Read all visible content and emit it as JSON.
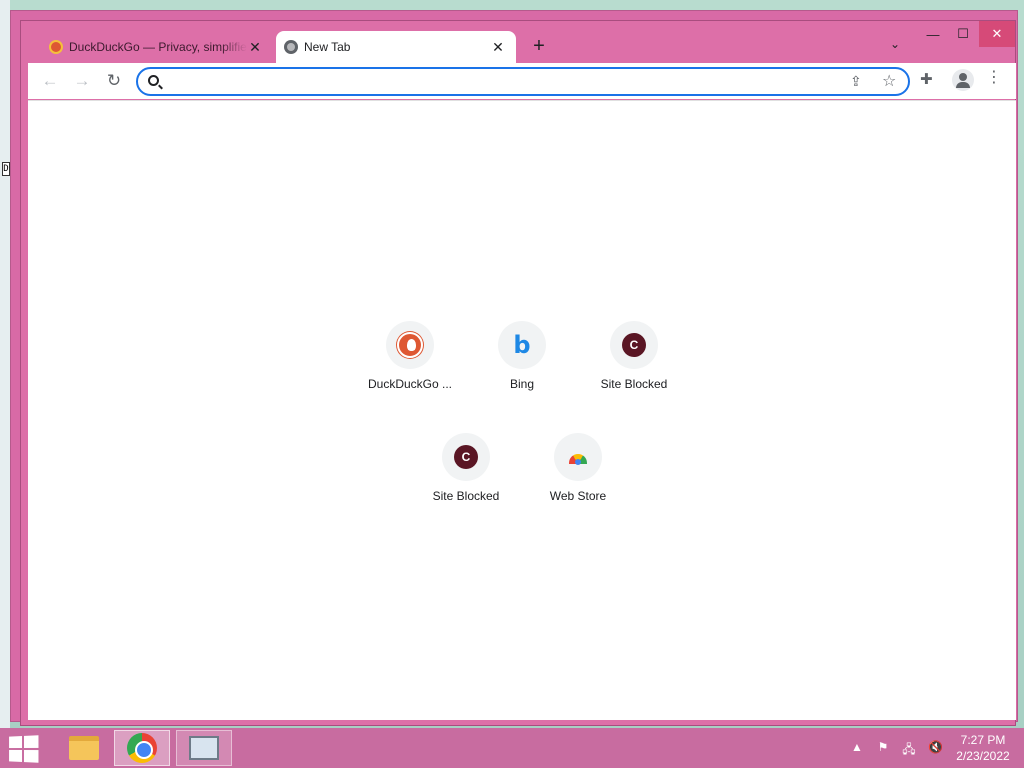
{
  "browser": {
    "tabs": [
      {
        "title": "DuckDuckGo — Privacy, simplified.",
        "favicon": "duckduckgo-icon",
        "active": false
      },
      {
        "title": "New Tab",
        "favicon": "globe-icon",
        "active": true
      }
    ],
    "close_glyph": "✕",
    "newtab_glyph": "+",
    "tabsearch_glyph": "⌄",
    "window_controls": {
      "minimize": "—",
      "maximize": "☐",
      "close": "✕"
    },
    "nav": {
      "back": "←",
      "forward": "→",
      "reload": "↻"
    },
    "omnibox": {
      "value": "",
      "placeholder": ""
    },
    "toolbar_icons": {
      "share": "⇪",
      "bookmark": "☆",
      "extensions": "✚",
      "menu": "⋮"
    }
  },
  "shortcuts": [
    {
      "label": "DuckDuckGo ...",
      "icon": "duckduckgo-icon"
    },
    {
      "label": "Bing",
      "icon": "bing-icon",
      "glyph": "b"
    },
    {
      "label": "Site Blocked",
      "icon": "letter-c-icon",
      "glyph": "C"
    },
    {
      "label": "Site Blocked",
      "icon": "letter-c-icon",
      "glyph": "C"
    },
    {
      "label": "Web Store",
      "icon": "web-store-icon"
    }
  ],
  "taskbar": {
    "apps": [
      "file-explorer-icon",
      "chrome-icon",
      "system-monitor-icon"
    ],
    "tray": {
      "show_hidden": "▲",
      "flag": "⚑",
      "network": "🖧",
      "volume": "🔇"
    },
    "clock": {
      "time": "7:27 PM",
      "date": "2/23/2022"
    }
  },
  "colors": {
    "window_frame": "#dd6fa8",
    "taskbar": "#c86ca0",
    "omnibox_focus": "#1a73e8",
    "blocked_icon": "#5a1624"
  }
}
